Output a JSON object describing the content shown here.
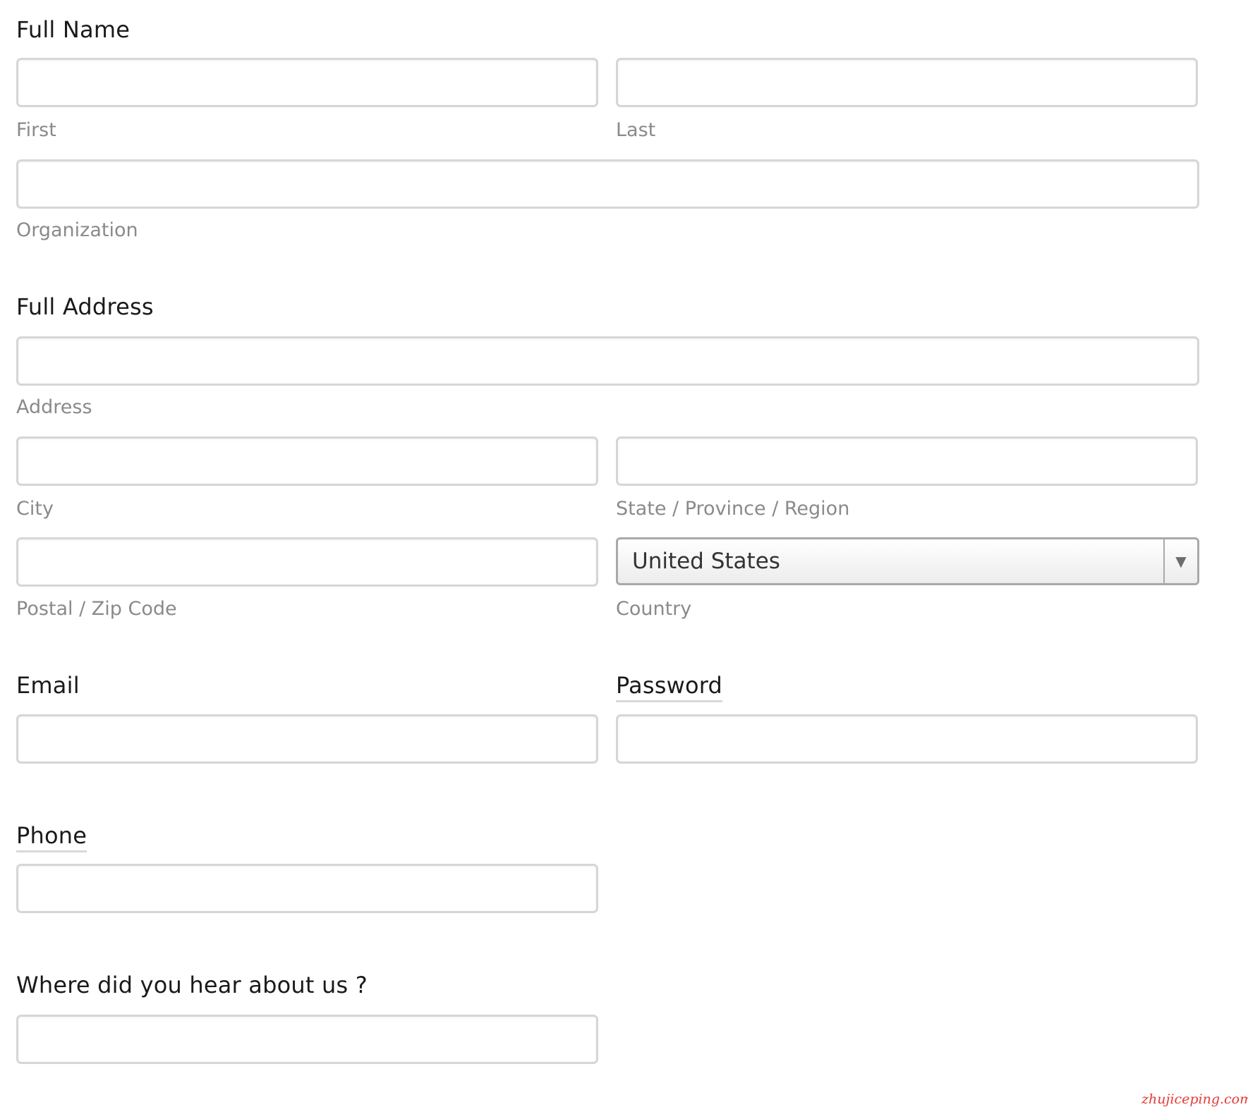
{
  "full_name": {
    "heading": "Full Name",
    "first": {
      "value": "",
      "sublabel": "First"
    },
    "last": {
      "value": "",
      "sublabel": "Last"
    },
    "organization": {
      "value": "",
      "sublabel": "Organization"
    }
  },
  "full_address": {
    "heading": "Full Address",
    "address": {
      "value": "",
      "sublabel": "Address"
    },
    "city": {
      "value": "",
      "sublabel": "City"
    },
    "state": {
      "value": "",
      "sublabel": "State / Province / Region"
    },
    "postal": {
      "value": "",
      "sublabel": "Postal / Zip Code"
    },
    "country": {
      "selected": "United States",
      "sublabel": "Country",
      "arrow_icon": "triangle-down-icon"
    }
  },
  "email": {
    "heading": "Email",
    "value": ""
  },
  "password": {
    "heading": "Password",
    "value": ""
  },
  "phone": {
    "heading": "Phone",
    "value": ""
  },
  "referral": {
    "heading": "Where did you hear about us ?",
    "value": ""
  },
  "watermark": "zhujiceping.com",
  "colors": {
    "field_border": "#d6d6d6",
    "sublabel": "#8a8a8a",
    "heading": "#1a1a1a",
    "watermark": "#e53935"
  }
}
